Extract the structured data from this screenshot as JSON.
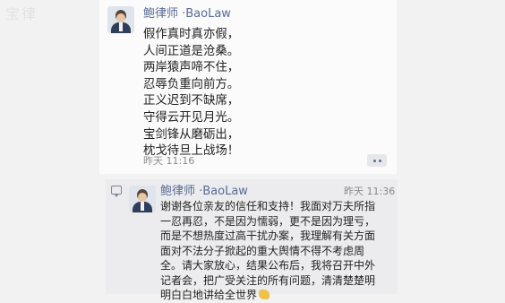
{
  "watermark": "宝律",
  "post": {
    "author": "鲍律师 ·BaoLaw",
    "lines": [
      "假作真时真亦假，",
      "人间正道是沧桑。",
      "两岸猿声啼不住，",
      "忍辱负重向前方。",
      "正义迟到不缺席，",
      "守得云开见月光。",
      "宝剑锋从磨砺出，",
      "枕戈待旦上战场！"
    ],
    "time": "昨天 11:16",
    "more_icon": "more-dots-icon"
  },
  "comment": {
    "author": "鲍律师 ·BaoLaw",
    "time": "昨天 11:36",
    "icon": "comment-icon",
    "lines": [
      "谢谢各位亲友的信任和支持！我面对万夫所指",
      "一忍再忍，不是因为懦弱，更不是因为理亏，",
      "而是不想热度过高干扰办案，我理解有关方面",
      "面对不法分子掀起的重大舆情不得不考虑周",
      "全。请大家放心，结果公布后，我将召开中外",
      "记者会，把广受关注的所有问题，清清楚楚明",
      "明白白地讲给全世界"
    ],
    "emoji": "clapping-hands-icon"
  }
}
